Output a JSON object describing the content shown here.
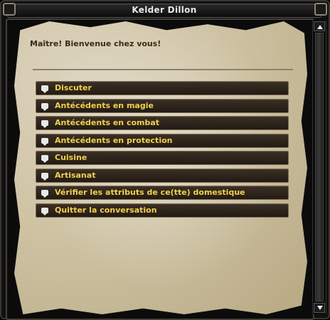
{
  "window": {
    "title": "Kelder Dillon"
  },
  "dialog": {
    "greeting": "Maître! Bienvenue chez vous!",
    "options": [
      {
        "label": "Discuter",
        "icon": "chat-bubble-icon"
      },
      {
        "label": "Antécédents en magie",
        "icon": "chat-bubble-icon"
      },
      {
        "label": "Antécédents en combat",
        "icon": "chat-bubble-icon"
      },
      {
        "label": "Antécédents en protection",
        "icon": "chat-bubble-icon"
      },
      {
        "label": "Cuisine",
        "icon": "chat-bubble-icon"
      },
      {
        "label": "Artisanat",
        "icon": "chat-bubble-icon"
      },
      {
        "label": "Vérifier les attributs de ce(tte) domestique",
        "icon": "chat-bubble-icon"
      },
      {
        "label": "Quitter la conversation",
        "icon": "chat-bubble-icon"
      }
    ]
  },
  "colors": {
    "option_text": "#f2d04d",
    "greeting_text": "#3a2a15",
    "parchment": "#cfc3a4",
    "option_bg": "#2e251c"
  }
}
